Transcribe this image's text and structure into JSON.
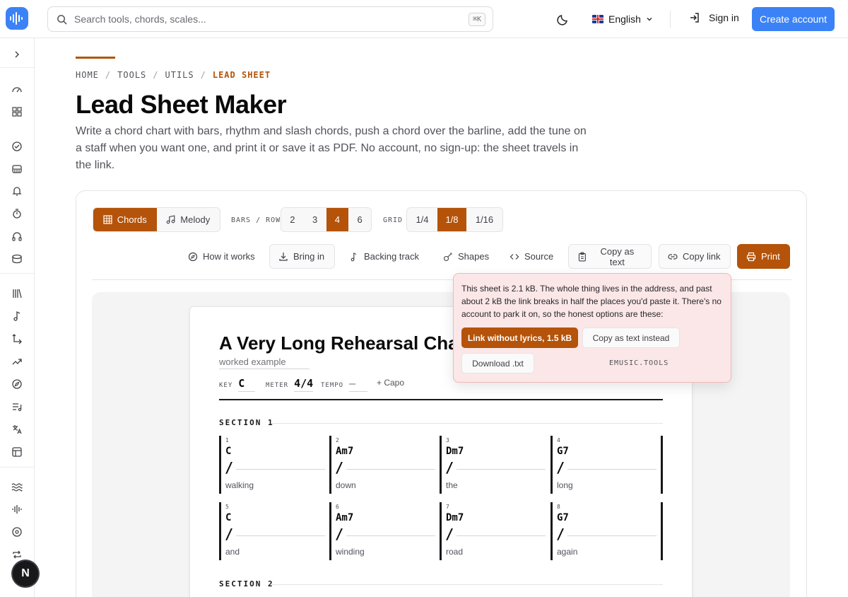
{
  "header": {
    "search_placeholder": "Search tools, chords, scales...",
    "search_shortcut": "⌘K",
    "language": "English",
    "sign_in": "Sign in",
    "create_account": "Create account",
    "brand_color": "#3b82f6"
  },
  "sidebar": {
    "icons": [
      "chevron-right-icon",
      "gauge-icon",
      "grid-icon",
      "check-circle-icon",
      "piano-icon",
      "bell-icon",
      "timer-icon",
      "headphones-icon",
      "drum-icon",
      "library-icon",
      "music-note-icon",
      "branch-icon",
      "trend-icon",
      "compass-icon",
      "list-music-icon",
      "translate-icon",
      "table-icon",
      "waves-icon",
      "audio-wave-icon",
      "disc-icon",
      "repeat-icon"
    ],
    "avatar_letter": "N"
  },
  "breadcrumb": {
    "items": [
      "HOME",
      "TOOLS",
      "UTILS"
    ],
    "current": "LEAD SHEET"
  },
  "page": {
    "title": "Lead Sheet Maker",
    "intro": "Write a chord chart with bars, rhythm and slash chords, push a chord over the barline, add the tune on a staff when you want one, and print it or save it as PDF. No account, no sign-up: the sheet travels in the link."
  },
  "mode_tabs": {
    "chords": "Chords",
    "melody": "Melody",
    "active": "Chords"
  },
  "bars_per_row": {
    "label": "BARS / ROW",
    "options": [
      "2",
      "3",
      "4",
      "6"
    ],
    "selected": "4"
  },
  "grid": {
    "label": "GRID",
    "options": [
      "1/4",
      "1/8",
      "1/16"
    ],
    "selected": "1/8"
  },
  "toolbar": {
    "how_it_works": "How it works",
    "bring_in": "Bring in",
    "backing_track": "Backing track",
    "shapes": "Shapes",
    "source": "Source",
    "copy_as_text": "Copy as text",
    "copy_link": "Copy link",
    "print": "Print",
    "accent_color": "#b45309"
  },
  "sheet": {
    "title": "A Very Long Rehearsal Chart",
    "subtitle": "worked example",
    "key_label": "KEY",
    "key": "C",
    "meter_label": "METER",
    "meter": "4/4",
    "tempo_label": "TEMPO",
    "tempo": "—",
    "capo": "+ Capo",
    "sections": [
      {
        "name": "SECTION 1",
        "bars": [
          {
            "num": "1",
            "chord": "C",
            "slash": "/",
            "lyric": "walking"
          },
          {
            "num": "2",
            "chord": "Am7",
            "slash": "/",
            "lyric": "down"
          },
          {
            "num": "3",
            "chord": "Dm7",
            "slash": "/",
            "lyric": "the"
          },
          {
            "num": "4",
            "chord": "G7",
            "slash": "/",
            "lyric": "long"
          },
          {
            "num": "5",
            "chord": "C",
            "slash": "/",
            "lyric": "and"
          },
          {
            "num": "6",
            "chord": "Am7",
            "slash": "/",
            "lyric": "winding"
          },
          {
            "num": "7",
            "chord": "Dm7",
            "slash": "/",
            "lyric": "road"
          },
          {
            "num": "8",
            "chord": "G7",
            "slash": "/",
            "lyric": "again"
          }
        ]
      },
      {
        "name": "SECTION 2",
        "bars": []
      }
    ]
  },
  "popover": {
    "message": "This sheet is 2.1 kB. The whole thing lives in the address, and past about 2 kB the link breaks in half the places you'd paste it. There's no account to park it on, so the honest options are these:",
    "link_without_lyrics": "Link without lyrics, 1.5 kB",
    "copy_as_text_instead": "Copy as text instead",
    "download_txt": "Download .txt",
    "brand": "EMUSIC.TOOLS",
    "background_color": "#fbe7e7"
  }
}
